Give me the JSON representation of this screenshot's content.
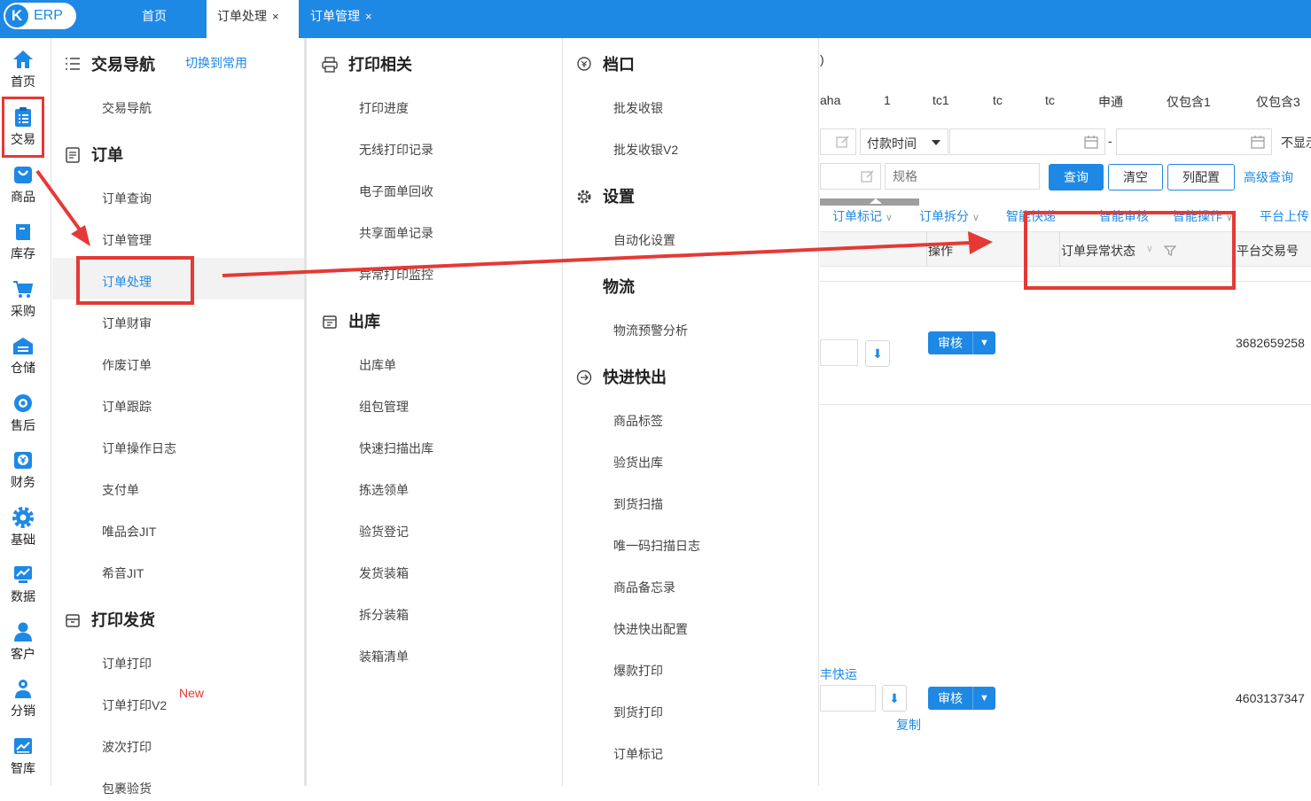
{
  "app": {
    "logo_letter": "K",
    "logo_text": "ERP",
    "brand_color": "#1e88e5",
    "annotation_color": "#e53935"
  },
  "top_tabs": [
    {
      "label": "首页",
      "closable": false,
      "active": false
    },
    {
      "label": "订单处理",
      "closable": true,
      "active": true
    },
    {
      "label": "订单管理",
      "closable": true,
      "active": false
    }
  ],
  "close_glyph": "×",
  "left_nav": [
    {
      "label": "首页",
      "icon": "home-icon"
    },
    {
      "label": "交易",
      "icon": "clipboard-icon"
    },
    {
      "label": "商品",
      "icon": "bag-icon"
    },
    {
      "label": "库存",
      "icon": "book-icon"
    },
    {
      "label": "采购",
      "icon": "cart-icon"
    },
    {
      "label": "仓储",
      "icon": "warehouse-icon"
    },
    {
      "label": "售后",
      "icon": "service-icon"
    },
    {
      "label": "财务",
      "icon": "money-icon"
    },
    {
      "label": "基础",
      "icon": "gear-icon"
    },
    {
      "label": "数据",
      "icon": "chart-icon"
    },
    {
      "label": "客户",
      "icon": "user-icon"
    },
    {
      "label": "分销",
      "icon": "network-icon"
    },
    {
      "label": "智库",
      "icon": "library-icon"
    }
  ],
  "menu": {
    "col1": {
      "nav_header": "交易导航",
      "switch_link": "切换到常用",
      "nav_items": [
        "交易导航"
      ],
      "order_header": "订单",
      "order_items": [
        "订单查询",
        "订单管理",
        "订单处理",
        "订单财审",
        "作废订单",
        "订单跟踪",
        "订单操作日志",
        "支付单",
        "唯品会JIT",
        "希音JIT"
      ],
      "selected": "订单处理",
      "print_header": "打印发货",
      "print_items": [
        "订单打印",
        "订单打印V2",
        "波次打印",
        "包裹验货"
      ],
      "new_tag": "New"
    },
    "col2": {
      "print_header": "打印相关",
      "print_items": [
        "打印进度",
        "无线打印记录",
        "电子面单回收",
        "共享面单记录",
        "异常打印监控"
      ],
      "out_header": "出库",
      "out_items": [
        "出库单",
        "组包管理",
        "快速扫描出库",
        "拣选领单",
        "验货登记",
        "发货装箱",
        "拆分装箱",
        "装箱清单"
      ]
    },
    "col3": {
      "stall_header": "档口",
      "stall_items": [
        "批发收银",
        "批发收银V2"
      ],
      "settings_header": "设置",
      "settings_items": [
        "自动化设置"
      ],
      "logistics_header": "物流",
      "logistics_items": [
        "物流预警分析"
      ],
      "fast_header": "快进快出",
      "fast_items": [
        "商品标签",
        "验货出库",
        "到货扫描",
        "唯一码扫描日志",
        "商品备忘录",
        "快进快出配置",
        "爆款打印",
        "到货打印",
        "订单标记"
      ]
    }
  },
  "main": {
    "title_fragment": ")",
    "filter_chips": [
      "aha",
      "1",
      "tc1",
      "tc",
      "tc",
      "申通",
      "仅包含1",
      "仅包含3"
    ],
    "time_select": "付款时间",
    "date_dash": "-",
    "hide_label": "不显示",
    "spec_placeholder": "规格",
    "buttons": {
      "query": "查询",
      "clear": "清空",
      "columns": "列配置",
      "advanced": "高级查询"
    },
    "action_bar": [
      "订单标记",
      "订单拆分",
      "智能快递",
      "智能审核",
      "智能操作",
      "平台上传"
    ],
    "table_headers": {
      "ops": "操作",
      "exception": "订单异常状态",
      "platform_no": "平台交易号"
    },
    "rows": [
      {
        "audit": "审核",
        "platform_no": "3682659258"
      },
      {
        "link": "丰快运",
        "audit": "审核",
        "copy": "复制",
        "platform_no": "4603137347"
      }
    ]
  }
}
